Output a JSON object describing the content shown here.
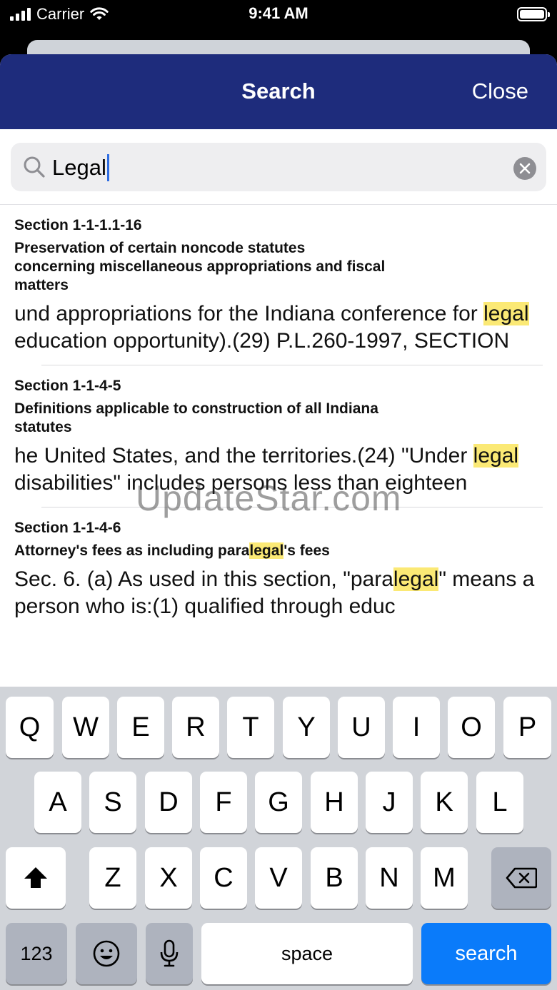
{
  "status_bar": {
    "carrier": "Carrier",
    "time": "9:41 AM"
  },
  "nav": {
    "title": "Search",
    "close_label": "Close"
  },
  "search": {
    "query": "Legal"
  },
  "results": [
    {
      "section": "Section 1-1-1.1-16",
      "title": "Preservation of certain noncode statutes concerning miscellaneous appropriations and fiscal matters",
      "snippet_parts": [
        "und appropriations for the Indiana conference for ",
        "legal",
        " education opportunity).(29) P.L.260-1997, SECTION"
      ]
    },
    {
      "section": "Section 1-1-4-5",
      "title": "Definitions applicable to construction of all Indiana statutes",
      "snippet_parts": [
        "he United States, and the territories.(24) \"Under ",
        "legal",
        " disabilities\" includes persons less than eighteen"
      ]
    },
    {
      "section": "Section 1-1-4-6",
      "title_parts": [
        "Attorney's fees as including para",
        "legal",
        "'s fees"
      ],
      "snippet_parts": [
        "Sec. 6. (a) As used in this section, \"para",
        "legal",
        "\" means a person who is:(1) qualified through educ"
      ]
    }
  ],
  "watermark": "UpdateStar.com",
  "keyboard": {
    "row1": [
      "Q",
      "W",
      "E",
      "R",
      "T",
      "Y",
      "U",
      "I",
      "O",
      "P"
    ],
    "row2": [
      "A",
      "S",
      "D",
      "F",
      "G",
      "H",
      "J",
      "K",
      "L"
    ],
    "row3": [
      "Z",
      "X",
      "C",
      "V",
      "B",
      "N",
      "M"
    ],
    "numbers_label": "123",
    "space_label": "space",
    "search_label": "search"
  },
  "icons": {
    "search": "magnifier-icon",
    "clear": "clear-x-icon",
    "shift": "shift-arrow-icon",
    "backspace": "backspace-icon",
    "emoji": "emoji-icon",
    "mic": "microphone-icon"
  },
  "colors": {
    "nav_bg": "#1e2c7c",
    "highlight": "#fbe975",
    "search_key": "#0a7bfa"
  }
}
